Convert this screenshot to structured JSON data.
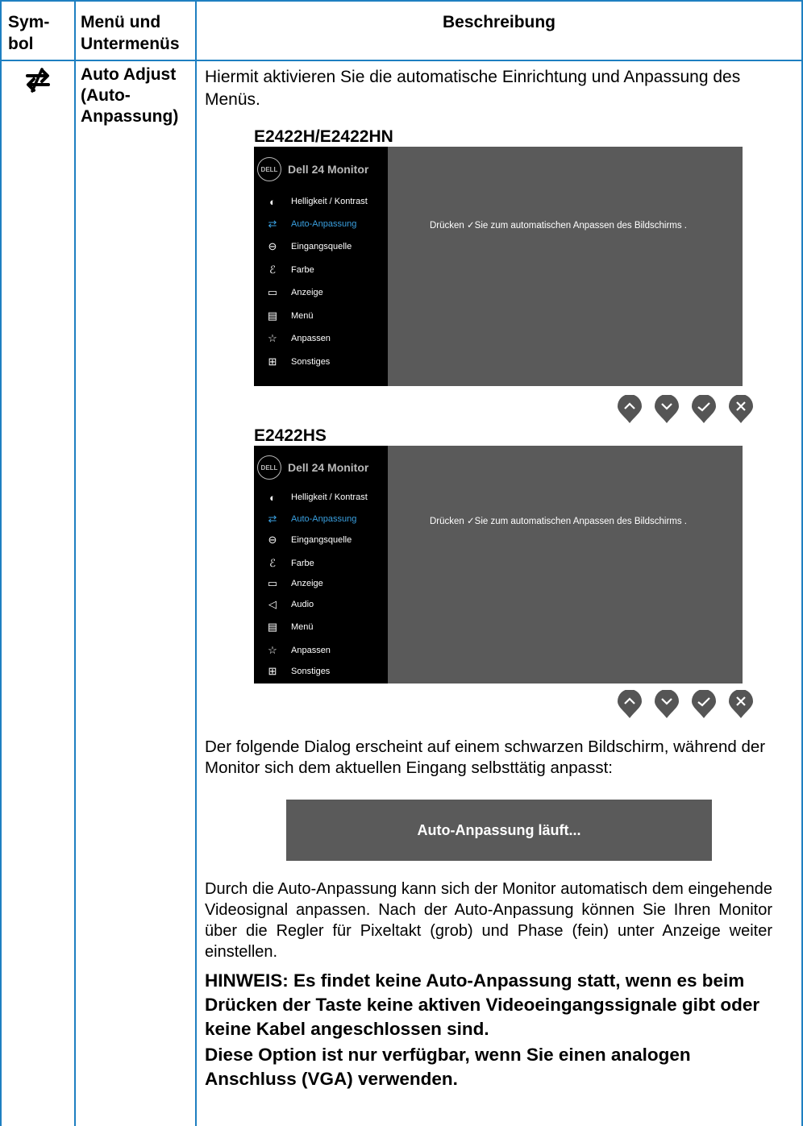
{
  "header": {
    "col1": "Sym-\nbol",
    "col2": "Menü und\nUntermenüs",
    "col3": "Beschreibung"
  },
  "row": {
    "symbol_icon": "auto-adjust-icon",
    "menu_name": "Auto Adjust\n(Auto-\nAnpassung)",
    "intro": "Hiermit aktivieren Sie die automatische Einrichtung und Anpassung des Menüs."
  },
  "osd1": {
    "model": "E2422H/E2422HN",
    "brand": "Dell 24 Monitor",
    "logo": "DELL",
    "items": [
      {
        "icon": "brightness-icon",
        "label": "Helligkeit / Kontrast"
      },
      {
        "icon": "auto-adjust-icon",
        "label": "Auto-Anpassung"
      },
      {
        "icon": "input-source-icon",
        "label": "Eingangsquelle"
      },
      {
        "icon": "color-icon",
        "label": "Farbe"
      },
      {
        "icon": "display-icon",
        "label": "Anzeige"
      },
      {
        "icon": "menu-icon",
        "label": "Menü"
      },
      {
        "icon": "personalize-icon",
        "label": "Anpassen"
      },
      {
        "icon": "others-icon",
        "label": "Sonstiges"
      }
    ],
    "message": "Drücken ✓Sie zum automatischen Anpassen des Bildschirms ."
  },
  "osd2": {
    "model": "E2422HS",
    "brand": "Dell 24 Monitor",
    "logo": "DELL",
    "items": [
      {
        "icon": "brightness-icon",
        "label": "Helligkeit / Kontrast"
      },
      {
        "icon": "auto-adjust-icon",
        "label": "Auto-Anpassung"
      },
      {
        "icon": "input-source-icon",
        "label": "Eingangsquelle"
      },
      {
        "icon": "color-icon",
        "label": "Farbe"
      },
      {
        "icon": "display-icon",
        "label": "Anzeige"
      },
      {
        "icon": "audio-icon",
        "label": "Audio"
      },
      {
        "icon": "menu-icon",
        "label": "Menü"
      },
      {
        "icon": "personalize-icon",
        "label": "Anpassen"
      },
      {
        "icon": "others-icon",
        "label": "Sonstiges"
      }
    ],
    "message": "Drücken ✓Sie zum automatischen Anpassen des Bildschirms ."
  },
  "buttons": [
    "up-icon",
    "down-icon",
    "check-icon",
    "close-icon"
  ],
  "dialog_intro": "Der folgende Dialog erscheint auf einem schwarzen Bildschirm, während der Monitor sich dem aktuellen Eingang selbsttätig anpasst:",
  "dialog_text": "Auto-Anpassung läuft...",
  "description": "Durch die Auto-Anpassung kann sich der Monitor automatisch dem eingehende Videosignal anpassen. Nach der Auto-Anpassung können Sie Ihren Monitor über die Regler für Pixeltakt (grob) und Phase (fein) unter Anzeige weiter einstellen.",
  "note1": "HINWEIS: Es findet keine Auto-Anpassung statt, wenn es beim Drücken der Taste keine aktiven Videoeingangssignale gibt oder keine Kabel angeschlossen sind.",
  "note2": "Diese Option ist nur verfügbar, wenn Sie einen analogen Anschluss (VGA) verwenden.",
  "colors": {
    "rule": "#1e7fc1",
    "osd_bg": "#5a5a5a",
    "active": "#3aa0e0"
  }
}
